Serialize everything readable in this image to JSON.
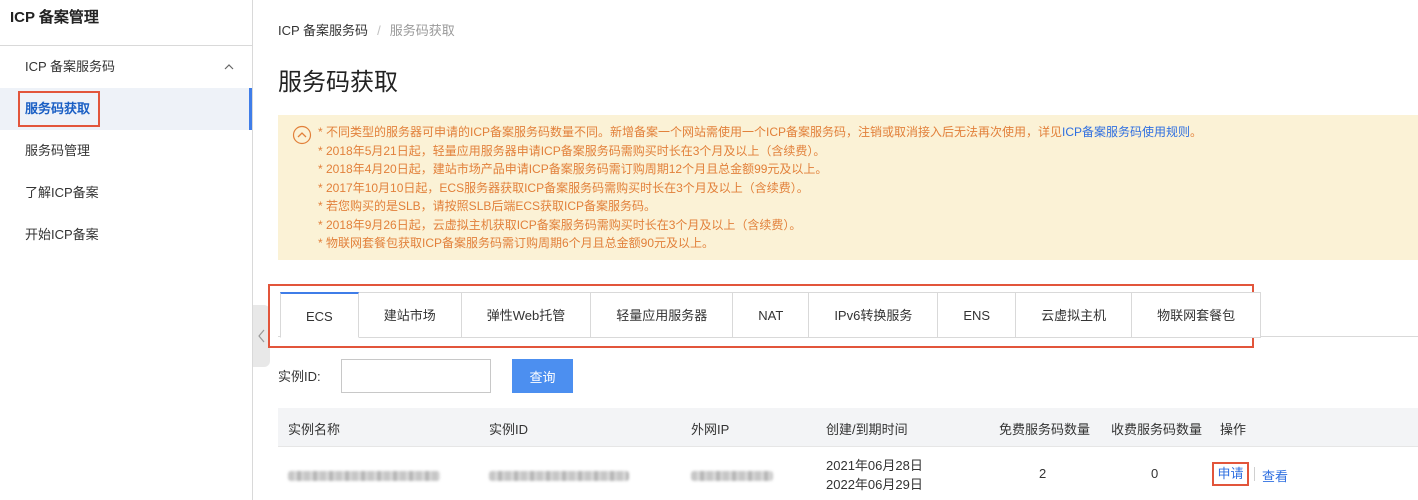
{
  "sidebar": {
    "title": "ICP 备案管理",
    "group_label": "ICP 备案服务码",
    "items": [
      {
        "label": "服务码获取"
      },
      {
        "label": "服务码管理"
      },
      {
        "label": "了解ICP备案"
      },
      {
        "label": "开始ICP备案"
      }
    ]
  },
  "breadcrumb": {
    "parent": "ICP 备案服务码",
    "separator": "/",
    "current": "服务码获取"
  },
  "page_title": "服务码获取",
  "notice": {
    "lines": [
      "* 不同类型的服务器可申请的ICP备案服务码数量不同。新增备案一个网站需使用一个ICP备案服务码，注销或取消接入后无法再次使用，详见",
      "* 2018年5月21日起，轻量应用服务器申请ICP备案服务码需购买时长在3个月及以上（含续费）。",
      "* 2018年4月20日起，建站市场产品申请ICP备案服务码需订购周期12个月且总金额99元及以上。",
      "* 2017年10月10日起，ECS服务器获取ICP备案服务码需购买时长在3个月及以上（含续费）。",
      "* 若您购买的是SLB，请按照SLB后端ECS获取ICP备案服务码。",
      "* 2018年9月26日起，云虚拟主机获取ICP备案服务码需购买时长在3个月及以上（含续费）。",
      "* 物联网套餐包获取ICP备案服务码需订购周期6个月且总金额90元及以上。"
    ],
    "link_text": "ICP备案服务码使用规则",
    "link_suffix": "。",
    "accent_color": "#e2803a"
  },
  "tabs": [
    {
      "label": "ECS",
      "active": true
    },
    {
      "label": "建站市场"
    },
    {
      "label": "弹性Web托管"
    },
    {
      "label": "轻量应用服务器"
    },
    {
      "label": "NAT"
    },
    {
      "label": "IPv6转换服务"
    },
    {
      "label": "ENS"
    },
    {
      "label": "云虚拟主机"
    },
    {
      "label": "物联网套餐包"
    }
  ],
  "search": {
    "label": "实例ID:",
    "value": "",
    "button": "查询"
  },
  "table": {
    "columns": [
      "实例名称",
      "实例ID",
      "外网IP",
      "创建/到期时间",
      "免费服务码数量",
      "收费服务码数量",
      "操作"
    ],
    "rows": [
      {
        "created": "2021年06月28日",
        "expires": "2022年06月29日",
        "free_count": "2",
        "paid_count": "0",
        "actions": [
          "申请",
          "查看"
        ]
      }
    ]
  },
  "colors": {
    "accent": "#3f7de8",
    "link": "#2f6fe0",
    "highlight_box": "#e2553b",
    "notice_bg": "#fbf2d6"
  }
}
